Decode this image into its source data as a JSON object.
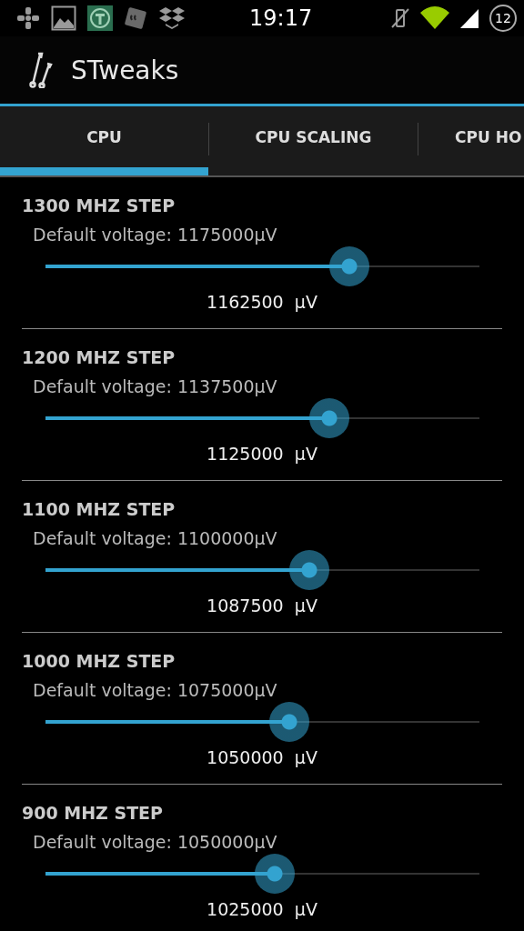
{
  "status_bar": {
    "time": "19:17",
    "badge": "12"
  },
  "action_bar": {
    "title": "STweaks"
  },
  "tabs": [
    {
      "label": "CPU",
      "selected": true
    },
    {
      "label": "CPU SCALING",
      "selected": false
    },
    {
      "label": "CPU HO",
      "selected": false
    }
  ],
  "settings": [
    {
      "title": "1300 MHZ STEP",
      "summary": "Default voltage: 1175000µV",
      "level": 0.7,
      "value": "1162500  µV"
    },
    {
      "title": "1200 MHZ STEP",
      "summary": "Default voltage: 1137500µV",
      "level": 0.654,
      "value": "1125000  µV"
    },
    {
      "title": "1100 MHZ STEP",
      "summary": "Default voltage: 1100000µV",
      "level": 0.608,
      "value": "1087500  µV"
    },
    {
      "title": "1000 MHZ STEP",
      "summary": "Default voltage: 1075000µV",
      "level": 0.562,
      "value": "1050000  µV"
    },
    {
      "title": "900 MHZ STEP",
      "summary": "Default voltage: 1050000µV",
      "level": 0.528,
      "value": "1025000  µV"
    }
  ]
}
